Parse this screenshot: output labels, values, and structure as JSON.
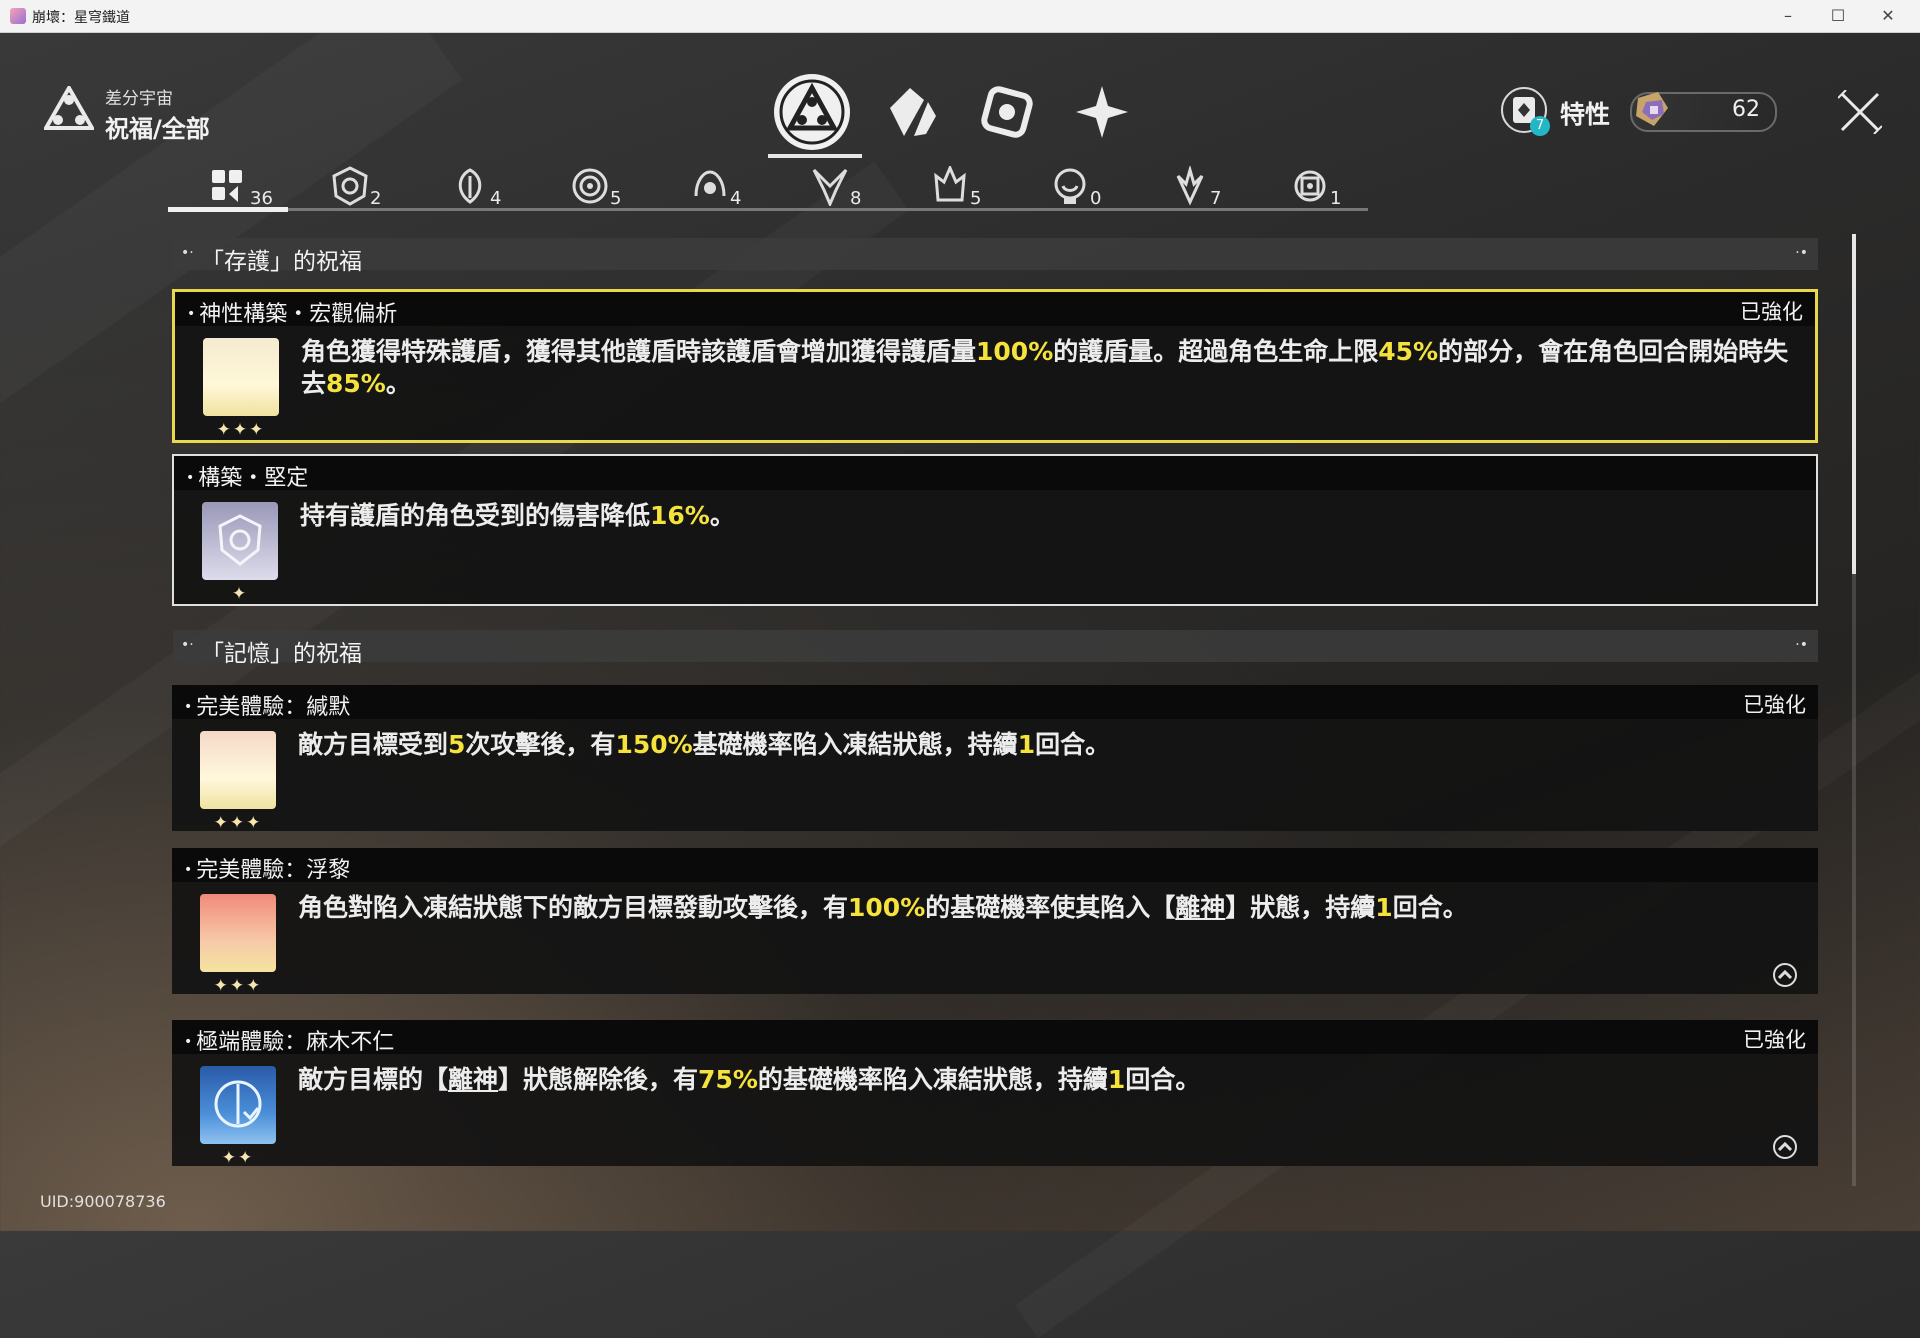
{
  "window": {
    "title": "崩壞：星穹鐵道",
    "minimize": "–",
    "maximize": "☐",
    "close": "✕"
  },
  "header": {
    "subtitle": "差分宇宙",
    "title": "祝福/全部"
  },
  "top_nav": [
    {
      "icon": "blessing-icon",
      "active": true
    },
    {
      "icon": "curio-icon",
      "active": false
    },
    {
      "icon": "equation-icon",
      "active": false
    },
    {
      "icon": "sparkle-icon",
      "active": false
    }
  ],
  "traits": {
    "label": "特性",
    "badge": "7"
  },
  "currency": {
    "value": "62",
    "icon": "cosmic-fragment-icon"
  },
  "filter_tabs": [
    {
      "icon": "all-grid-icon",
      "count": "36",
      "active": true
    },
    {
      "icon": "preservation-icon",
      "count": "2"
    },
    {
      "icon": "remembrance-icon",
      "count": "4"
    },
    {
      "icon": "nihility-icon",
      "count": "5"
    },
    {
      "icon": "abundance-icon",
      "count": "4"
    },
    {
      "icon": "the-hunt-icon",
      "count": "8"
    },
    {
      "icon": "destruction-icon",
      "count": "5"
    },
    {
      "icon": "elation-icon",
      "count": "0"
    },
    {
      "icon": "propagation-icon",
      "count": "7"
    },
    {
      "icon": "erudition-icon",
      "count": "1"
    }
  ],
  "sections": [
    {
      "label": "「存護」的祝福",
      "cards": [
        {
          "name": "神性構築・宏觀偏析",
          "status": "已強化",
          "stars": "✦✦✦",
          "desc_parts": [
            "角色獲得特殊護盾，獲得其他護盾時該護盾會增加獲得護盾量",
            "100%",
            "的護盾量。超過角色生命上限",
            "45%",
            "的部分，會在角色回合開始時失去",
            "85%",
            "。"
          ]
        },
        {
          "name": "構築・堅定",
          "status": "",
          "stars": "✦",
          "desc_parts": [
            "持有護盾的角色受到的傷害降低",
            "16%",
            "。"
          ]
        }
      ]
    },
    {
      "label": "「記憶」的祝福",
      "cards": [
        {
          "name": "完美體驗：緘默",
          "status": "已強化",
          "stars": "✦✦✦",
          "desc_parts": [
            "敵方目標受到",
            "5",
            "次攻擊後，有",
            "150%",
            "基礎機率陷入凍結狀態，持續",
            "1",
            "回合。"
          ]
        },
        {
          "name": "完美體驗：浮黎",
          "status": "",
          "stars": "✦✦✦",
          "desc_parts": [
            "角色對陷入凍結狀態下的敵方目標發動攻擊後，有",
            "100%",
            "的基礎機率使其陷入【",
            "離神",
            "】狀態，持續",
            "1",
            "回合。"
          ]
        },
        {
          "name": "極端體驗：麻木不仁",
          "status": "已強化",
          "stars": "✦✦",
          "desc_parts": [
            "敵方目標的【",
            "離神",
            "】狀態解除後，有",
            "75%",
            "的基礎機率陷入凍結狀態，持續",
            "1",
            "回合。"
          ]
        }
      ]
    }
  ],
  "uid": "UID:900078736",
  "colors": {
    "highlight": "#f5e23c",
    "selected_border": "#e7d84c",
    "badge": "#22b6c7"
  }
}
